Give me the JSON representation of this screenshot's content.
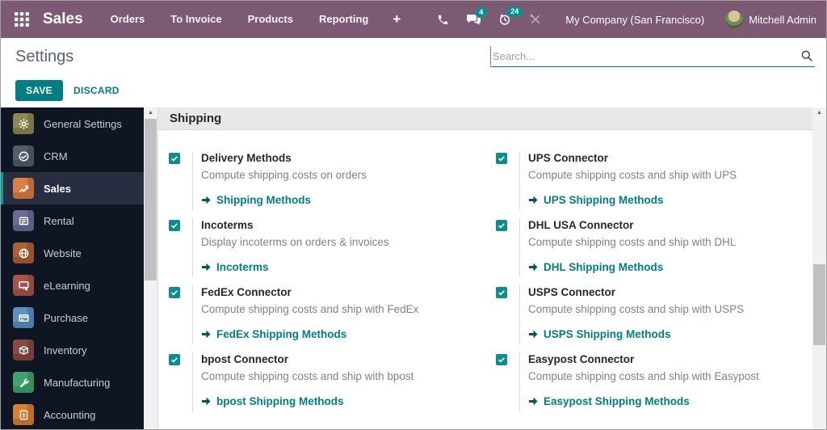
{
  "colors": {
    "topbar_bg": "#7d5a74",
    "accent_teal": "#017e84",
    "badge_teal": "#0c8e8f",
    "sidebar_bg": "#0e1523",
    "active_item_bg": "#282e3f",
    "link_arrow": "#01565f"
  },
  "topbar": {
    "brand": "Sales",
    "menu_items": [
      "Orders",
      "To Invoice",
      "Products",
      "Reporting"
    ],
    "plus_label": "+",
    "badge_messages": "4",
    "badge_activities": "24",
    "company": "My Company (San Francisco)",
    "user": "Mitchell Admin"
  },
  "header": {
    "title": "Settings",
    "search_placeholder": "Search...",
    "save_label": "SAVE",
    "discard_label": "DISCARD"
  },
  "sidebar": {
    "active": "Sales",
    "items": [
      {
        "label": "General Settings",
        "icon": "gear-icon",
        "color": "#8d8756"
      },
      {
        "label": "CRM",
        "icon": "handshake-icon",
        "color": "#545d6b"
      },
      {
        "label": "Sales",
        "icon": "chart-icon",
        "color": "#e07c45"
      },
      {
        "label": "Rental",
        "icon": "ledger-icon",
        "color": "#6a6b99"
      },
      {
        "label": "Website",
        "icon": "globe-icon",
        "color": "#ad5f36"
      },
      {
        "label": "eLearning",
        "icon": "presentation-icon",
        "color": "#a8544c"
      },
      {
        "label": "Purchase",
        "icon": "credit-card-icon",
        "color": "#5d8fc0"
      },
      {
        "label": "Inventory",
        "icon": "box-icon",
        "color": "#884a44"
      },
      {
        "label": "Manufacturing",
        "icon": "wrench-icon",
        "color": "#3fa36d"
      },
      {
        "label": "Accounting",
        "icon": "invoice-icon",
        "color": "#d58136"
      }
    ]
  },
  "settings": {
    "section_title": "Shipping",
    "items": [
      {
        "checked": true,
        "title": "Delivery Methods",
        "desc": "Compute shipping costs on orders",
        "link": "Shipping Methods"
      },
      {
        "checked": true,
        "title": "UPS Connector",
        "desc": "Compute shipping costs and ship with UPS",
        "link": "UPS Shipping Methods"
      },
      {
        "checked": true,
        "title": "Incoterms",
        "desc": "Display incoterms on orders & invoices",
        "link": "Incoterms"
      },
      {
        "checked": true,
        "title": "DHL USA Connector",
        "desc": "Compute shipping costs and ship with DHL",
        "link": "DHL Shipping Methods"
      },
      {
        "checked": true,
        "title": "FedEx Connector",
        "desc": "Compute shipping costs and ship with FedEx",
        "link": "FedEx Shipping Methods"
      },
      {
        "checked": true,
        "title": "USPS Connector",
        "desc": "Compute shipping costs and ship with USPS",
        "link": "USPS Shipping Methods"
      },
      {
        "checked": true,
        "title": "bpost Connector",
        "desc": "Compute shipping costs and ship with bpost",
        "link": "bpost Shipping Methods"
      },
      {
        "checked": true,
        "title": "Easypost Connector",
        "desc": "Compute shipping costs and ship with Easypost",
        "link": "Easypost Shipping Methods"
      }
    ]
  }
}
